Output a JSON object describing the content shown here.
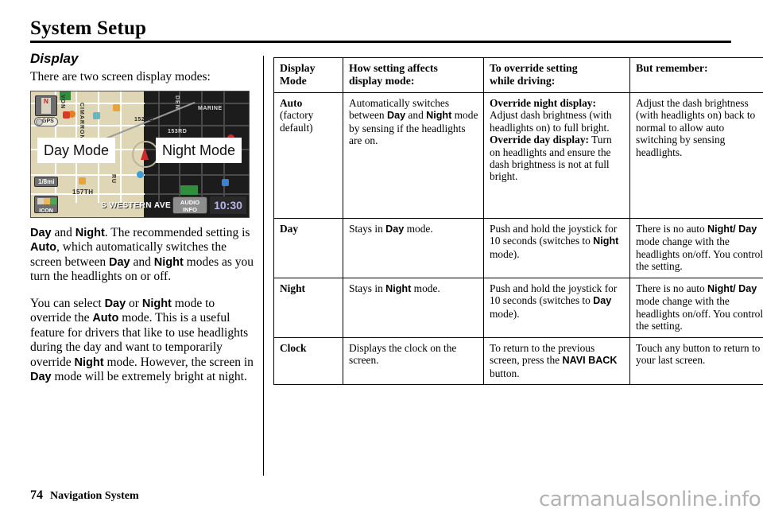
{
  "page": {
    "title": "System Setup",
    "footer_page_number": "74",
    "footer_section": "Navigation System",
    "watermark": "carmanualsonline.info"
  },
  "left_column": {
    "section_heading": "Display",
    "intro": "There are two screen display modes:",
    "nav_screen": {
      "day_callout": "Day Mode",
      "night_callout": "Night Mode",
      "compass_label": "N",
      "gps_label": "GPS",
      "scale_label": "1/8mi",
      "icon_button_label": "ICON",
      "street_label": "S WESTERN AVE",
      "audio_info_line1": "AUDIO",
      "audio_info_line2": "INFO",
      "clock": "10:30",
      "streets": [
        "VON",
        "CIMARRON",
        "DEN",
        "MARINE",
        "152ND",
        "153RD",
        "157TH",
        "RU"
      ]
    },
    "para1": {
      "full": "Day and Night. The recommended setting is Auto, which automatically switches the screen between Day and Night modes as you turn the headlights on or off."
    },
    "para2": {
      "full": "You can select Day or Night mode to override the Auto mode. This is a useful feature for drivers that like to use headlights during the day and want to temporarily override Night mode. However, the screen in Day mode will be extremely bright at night."
    }
  },
  "table": {
    "headers": [
      "Display Mode",
      "How setting affects display mode:",
      "To override setting while driving:",
      "But remember:"
    ],
    "header_lines": {
      "c1_l1": "Display",
      "c1_l2": "Mode",
      "c2_l1": "How setting affects",
      "c2_l2": "display mode:",
      "c3_l1": "To override setting",
      "c3_l2": "while driving:",
      "c4_l1": "But remember:"
    },
    "rows": [
      {
        "mode": "Auto",
        "mode_sub": "(factory default)",
        "affects": "Automatically switches between Day and Night mode by sensing if the headlights are on.",
        "override_label_1": "Override night display:",
        "override_text_1": "Adjust dash brightness (with headlights on) to full bright.",
        "override_label_2": "Override day display:",
        "override_text_2": "Turn on headlights and ensure the dash brightness is not at full bright.",
        "remember": "Adjust the dash brightness (with headlights on)  back to normal to allow auto switching by sensing headlights."
      },
      {
        "mode": "Day",
        "mode_sub": "",
        "affects": "Stays in Day mode.",
        "override_text_1": "Push and hold the joystick for 10 seconds (switches to Night mode).",
        "remember": "There is no auto Night/Day mode change with the headlights on/off. You control the setting."
      },
      {
        "mode": "Night",
        "mode_sub": "",
        "affects": "Stays in Night mode.",
        "override_text_1": "Push and hold the joystick for 10 seconds (switches to Day mode).",
        "remember": "There is no auto Night/Day mode change with the headlights on/off. You control the setting."
      },
      {
        "mode": "Clock",
        "mode_sub": "",
        "affects": "Displays the clock on the screen.",
        "override_text_1": "To return to the previous screen, press the NAVI BACK button.",
        "remember": "Touch any button to return to your last screen."
      }
    ]
  },
  "colors": {
    "day_map_bg": "#ded6b4",
    "night_map_bg": "#1c1c1c",
    "clock_text": "#b9b4ee",
    "vehicle_arrow": "#cf2a2a",
    "watermark": "#b2b2b2"
  }
}
